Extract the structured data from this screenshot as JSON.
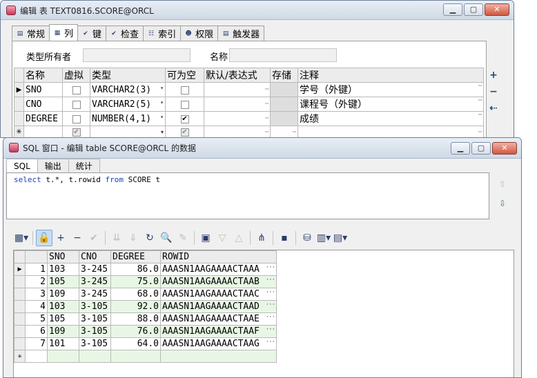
{
  "editor": {
    "title": "编辑 表 TEXT0816.SCORE@ORCL",
    "tabs": [
      {
        "label": "常规",
        "icon": "general-icon"
      },
      {
        "label": "列",
        "icon": "columns-icon"
      },
      {
        "label": "键",
        "icon": "key-icon"
      },
      {
        "label": "检查",
        "icon": "check-icon"
      },
      {
        "label": "索引",
        "icon": "index-icon"
      },
      {
        "label": "权限",
        "icon": "privileges-icon"
      },
      {
        "label": "触发器",
        "icon": "trigger-icon"
      }
    ],
    "owner_label": "类型所有者",
    "name_label": "名称",
    "columns_header": [
      "名称",
      "虚拟",
      "类型",
      "可为空",
      "默认/表达式",
      "存储",
      "注释"
    ],
    "rows": [
      {
        "name": "SNO",
        "type": "VARCHAR2(3)",
        "nullable": false,
        "comment": "学号（外键）"
      },
      {
        "name": "CNO",
        "type": "VARCHAR2(5)",
        "nullable": false,
        "comment": "课程号（外键）"
      },
      {
        "name": "DEGREE",
        "type": "NUMBER(4,1)",
        "nullable": true,
        "comment": "成绩"
      }
    ],
    "side_tools": [
      {
        "name": "add-column-icon",
        "glyph": "+"
      },
      {
        "name": "remove-column-icon",
        "glyph": "−"
      },
      {
        "name": "move-column-icon",
        "glyph": "⇠"
      }
    ]
  },
  "sql": {
    "title": "SQL 窗口 - 编辑 table SCORE@ORCL 的数据",
    "tabs": [
      "SQL",
      "输出",
      "统计"
    ],
    "query": {
      "select": "select",
      "cols": "t.*, t.rowid",
      "from": "from",
      "table": "SCORE t"
    },
    "result_columns": [
      "SNO",
      "CNO",
      "DEGREE",
      "ROWID"
    ],
    "result_rows": [
      {
        "n": "1",
        "sno": "103",
        "cno": "3-245",
        "degree": "86.0",
        "rowid": "AAASN1AAGAAAACTAAA"
      },
      {
        "n": "2",
        "sno": "105",
        "cno": "3-245",
        "degree": "75.0",
        "rowid": "AAASN1AAGAAAACTAAB"
      },
      {
        "n": "3",
        "sno": "109",
        "cno": "3-245",
        "degree": "68.0",
        "rowid": "AAASN1AAGAAAACTAAC"
      },
      {
        "n": "4",
        "sno": "103",
        "cno": "3-105",
        "degree": "92.0",
        "rowid": "AAASN1AAGAAAACTAAD"
      },
      {
        "n": "5",
        "sno": "105",
        "cno": "3-105",
        "degree": "88.0",
        "rowid": "AAASN1AAGAAAACTAAE"
      },
      {
        "n": "6",
        "sno": "109",
        "cno": "3-105",
        "degree": "76.0",
        "rowid": "AAASN1AAGAAAACTAAF"
      },
      {
        "n": "7",
        "sno": "101",
        "cno": "3-105",
        "degree": "64.0",
        "rowid": "AAASN1AAGAAAACTAAG"
      }
    ]
  },
  "colors": {
    "accent": "#1d3fb8",
    "alt_row": "#e8f7e5",
    "titlebar": "#cfd9e6"
  }
}
